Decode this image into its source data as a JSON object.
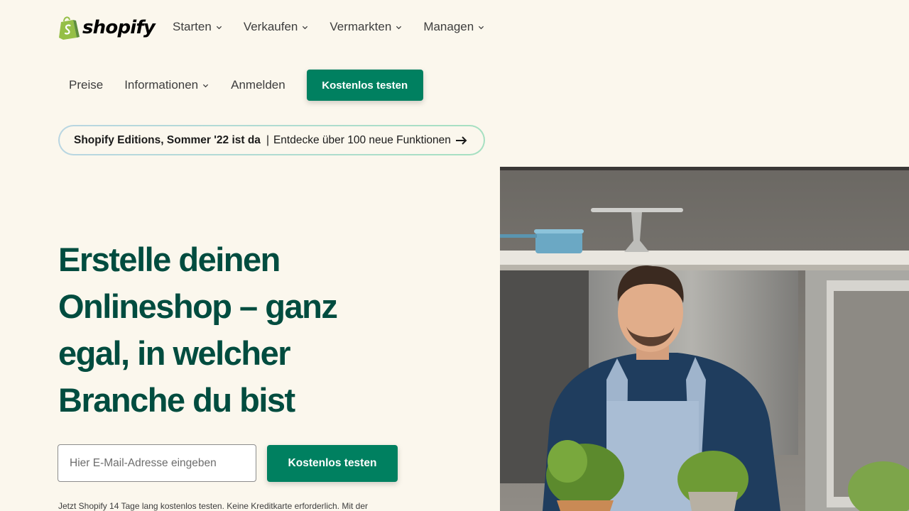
{
  "header": {
    "logo_text": "shopify",
    "nav": [
      {
        "label": "Starten"
      },
      {
        "label": "Verkaufen"
      },
      {
        "label": "Vermarkten"
      },
      {
        "label": "Managen"
      }
    ],
    "secondary_nav": {
      "pricing": "Preise",
      "info": "Informationen",
      "login": "Anmelden",
      "cta": "Kostenlos testen"
    }
  },
  "banner": {
    "highlight": "Shopify Editions, Sommer '22 ist da",
    "separator": "|",
    "text": "Entdecke über 100 neue Funktionen",
    "icon": "arrow-right-icon"
  },
  "hero": {
    "headline_lines": [
      "Erstelle deinen",
      "Onlineshop – ganz",
      "egal, in welcher",
      "Branche du bist"
    ],
    "email_placeholder": "Hier E-Mail-Adresse eingeben",
    "cta": "Kostenlos testen",
    "fine_print": "Jetzt Shopify 14 Tage lang kostenlos testen. Keine Kreditkarte erforderlich. Mit der"
  },
  "colors": {
    "background": "#fbf7ed",
    "brand_green": "#008060",
    "headline_green": "#004c3f",
    "logo_green": "#95bf47"
  }
}
